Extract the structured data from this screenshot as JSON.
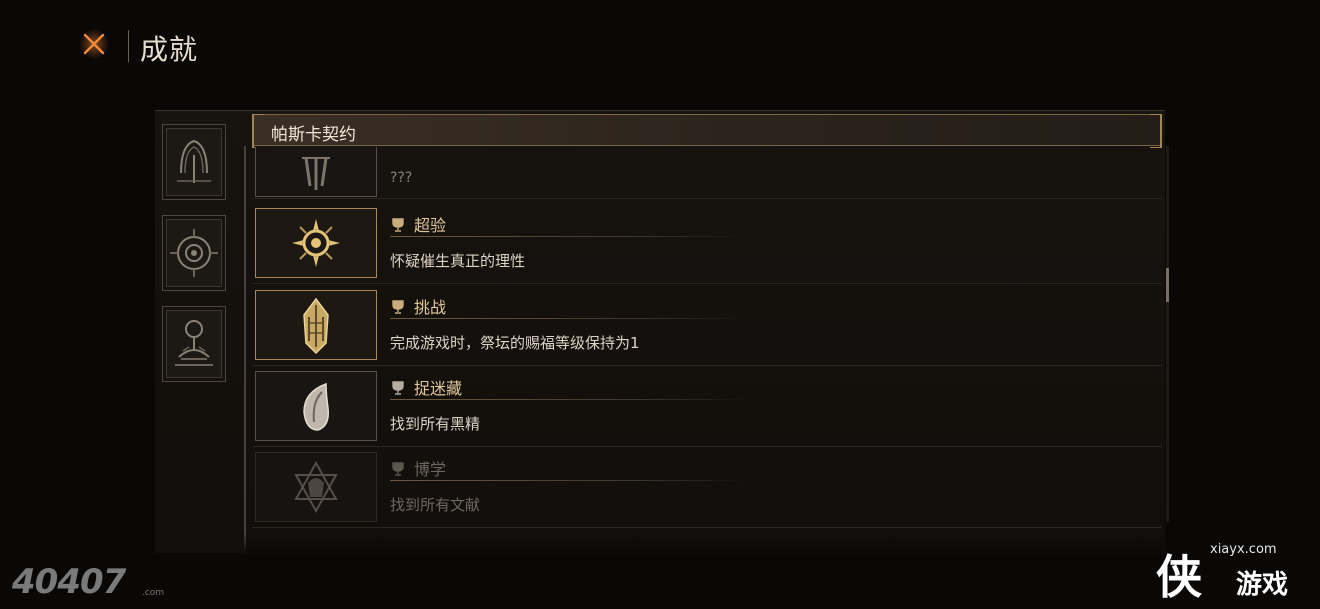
{
  "header": {
    "title": "成就",
    "close_icon": "close-x-icon",
    "accent": "#e8782a"
  },
  "categories": [
    {
      "icon": "arch-sigil-icon"
    },
    {
      "icon": "eye-compass-icon"
    },
    {
      "icon": "altar-icon"
    }
  ],
  "section": {
    "title": "帕斯卡契约"
  },
  "partial_top": {
    "desc": "???",
    "icon": "claw-sigil-icon"
  },
  "achievements": [
    {
      "name": "超验",
      "desc": "怀疑催生真正的理性",
      "icon": "compass-star-icon",
      "unlocked": true
    },
    {
      "name": "挑战",
      "desc": "完成游戏时，祭坛的赐福等级保持为1",
      "icon": "crystal-spire-icon",
      "unlocked": true
    },
    {
      "name": "捉迷藏",
      "desc": "找到所有黑精",
      "icon": "seed-pod-icon",
      "unlocked": true
    },
    {
      "name": "博学",
      "desc": "找到所有文献",
      "icon": "hexagram-helm-icon",
      "unlocked": false
    }
  ],
  "watermarks": {
    "left": "40407",
    "left_sub": ".com",
    "url": "xiayx.com",
    "brand_glyph": "侠",
    "brand_text": "游戏"
  },
  "colors": {
    "gold": "#e0c79c",
    "frame_gold": "#a8865a",
    "bg": "#0a0807"
  }
}
